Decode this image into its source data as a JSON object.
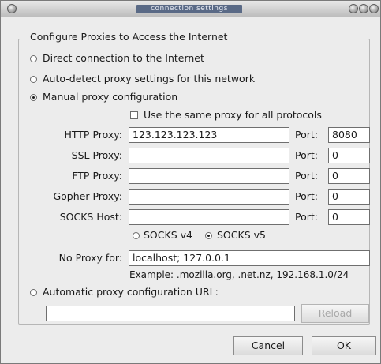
{
  "window": {
    "title": "connection settings"
  },
  "group": {
    "title": "Configure Proxies to Access the Internet"
  },
  "options": {
    "direct": "Direct connection to the Internet",
    "autodetect": "Auto-detect proxy settings for this network",
    "manual": "Manual proxy configuration",
    "selected": "manual"
  },
  "same_proxy": {
    "label": "Use the same proxy for all protocols",
    "checked": false
  },
  "proxies": {
    "http": {
      "label": "HTTP Proxy:",
      "host": "123.123.123.123",
      "port_label": "Port:",
      "port": "8080"
    },
    "ssl": {
      "label": "SSL Proxy:",
      "host": "",
      "port_label": "Port:",
      "port": "0"
    },
    "ftp": {
      "label": "FTP Proxy:",
      "host": "",
      "port_label": "Port:",
      "port": "0"
    },
    "gopher": {
      "label": "Gopher Proxy:",
      "host": "",
      "port_label": "Port:",
      "port": "0"
    },
    "socks": {
      "label": "SOCKS Host:",
      "host": "",
      "port_label": "Port:",
      "port": "0"
    }
  },
  "socks_version": {
    "v4": "SOCKS v4",
    "v5": "SOCKS v5",
    "selected": "v5"
  },
  "no_proxy": {
    "label": "No Proxy for:",
    "value": "localhost; 127.0.0.1",
    "example": "Example: .mozilla.org, .net.nz, 192.168.1.0/24"
  },
  "auto_url": {
    "label": "Automatic proxy configuration URL:",
    "value": ""
  },
  "buttons": {
    "reload": "Reload",
    "cancel": "Cancel",
    "ok": "OK"
  }
}
